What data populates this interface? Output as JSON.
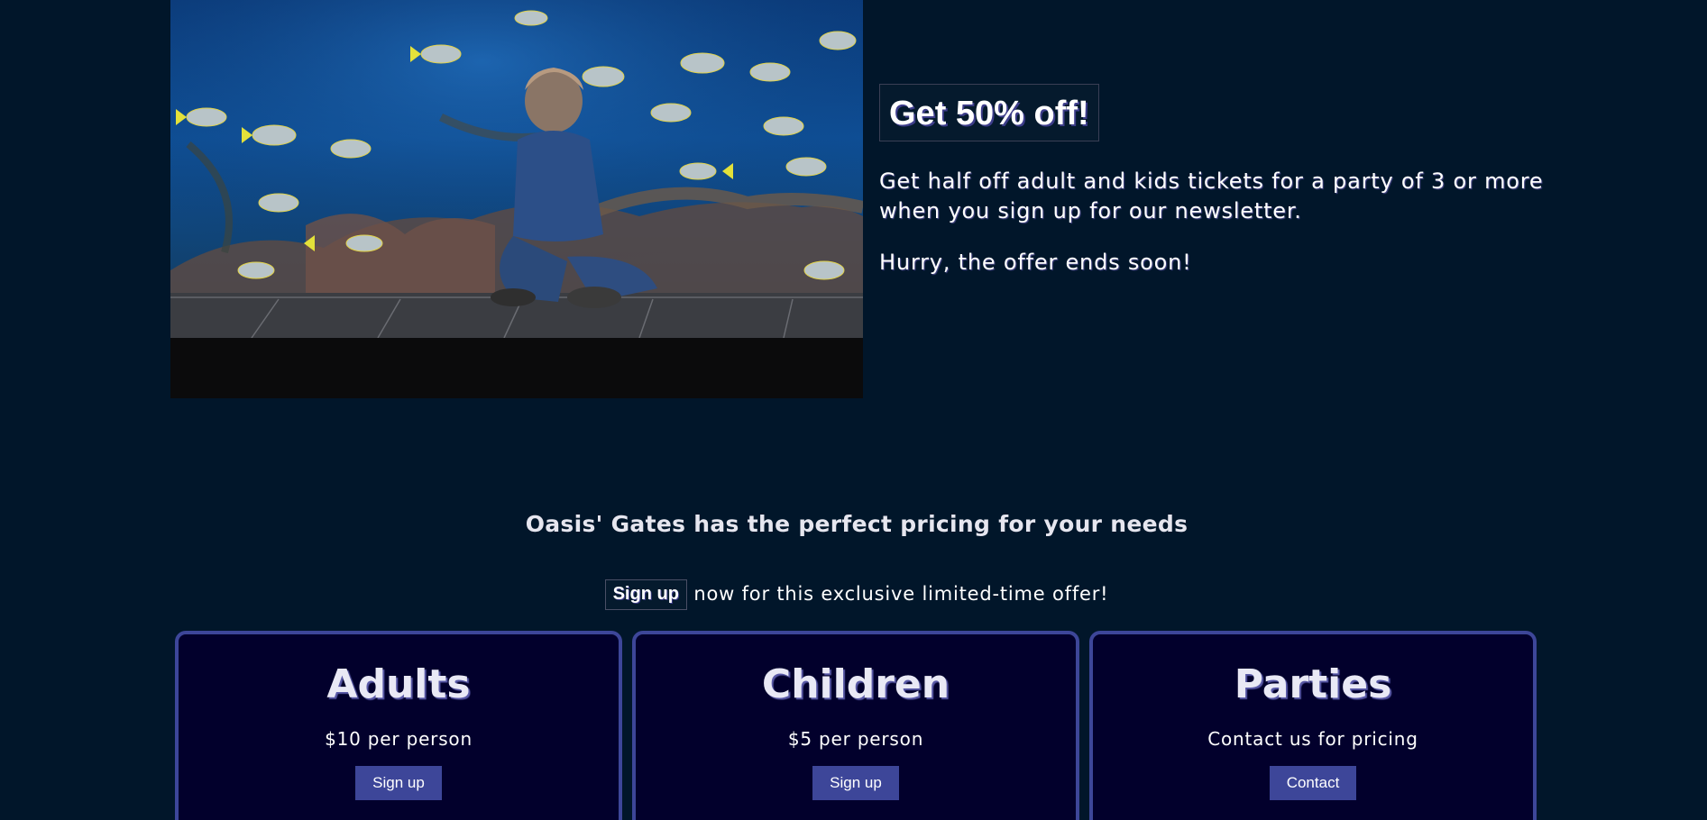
{
  "promo": {
    "image": {
      "name": "aquarium-photo",
      "depicts": "child-watching-fish-tank"
    },
    "heading": "Get 50% off!",
    "body": "Get half off adult and kids tickets for a party of 3 or more when you sign up for our newsletter.",
    "urgency": "Hurry, the offer ends soon!"
  },
  "pricing": {
    "title": "Oasis' Gates has the perfect pricing for your needs",
    "signup_link": "Sign up",
    "signup_text": "now for this exclusive limited-time offer!",
    "cards": [
      {
        "title": "Adults",
        "price": "$10 per person",
        "button": "Sign up"
      },
      {
        "title": "Children",
        "price": "$5 per person",
        "button": "Sign up"
      },
      {
        "title": "Parties",
        "price": "Contact us for pricing",
        "button": "Contact"
      }
    ]
  },
  "colors": {
    "background": "#01162a",
    "card_background": "#02002c",
    "accent": "#3d4699",
    "text": "#ffffff"
  }
}
